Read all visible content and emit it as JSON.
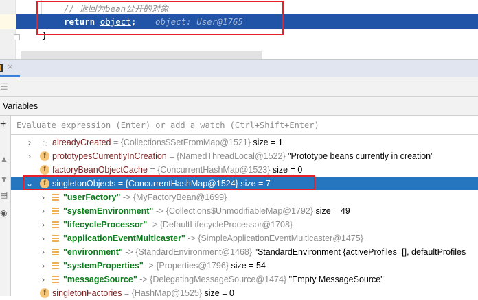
{
  "editor": {
    "comment": "// 返回为bean公开的对象",
    "return_kw": "return ",
    "return_obj": "object",
    "return_semi": ";",
    "inline_value": "object: User@1765",
    "brace": "}"
  },
  "toolbar": {
    "close_glyph": "×"
  },
  "variables": {
    "title": "Variables",
    "eval_placeholder": "Evaluate expression (Enter) or add a watch (Ctrl+Shift+Enter)",
    "add_glyph": "+",
    "rows": [
      {
        "name": "alreadyCreated",
        "value": " = {Collections$SetFromMap@1521}",
        "extra": "  size = 1"
      },
      {
        "name": "prototypesCurrentlyInCreation",
        "value": " = {NamedThreadLocal@1522}",
        "extra": " \"Prototype beans currently in creation\""
      },
      {
        "name": "factoryBeanObjectCache",
        "value": " = {ConcurrentHashMap@1523}",
        "extra": "  size = 0"
      },
      {
        "name": "singletonObjects",
        "value": " = {ConcurrentHashMap@1524}",
        "extra": "  size = 7"
      },
      {
        "key": "\"userFactory\"",
        "value": " -> {MyFactoryBean@1699}",
        "extra": ""
      },
      {
        "key": "\"systemEnvironment\"",
        "value": " -> {Collections$UnmodifiableMap@1792}",
        "extra": "  size = 49"
      },
      {
        "key": "\"lifecycleProcessor\"",
        "value": " -> {DefaultLifecycleProcessor@1708}",
        "extra": ""
      },
      {
        "key": "\"applicationEventMulticaster\"",
        "value": " -> {SimpleApplicationEventMulticaster@1475}",
        "extra": ""
      },
      {
        "key": "\"environment\"",
        "value": " -> {StandardEnvironment@1468}",
        "extra": " \"StandardEnvironment {activeProfiles=[], defaultProfiles"
      },
      {
        "key": "\"systemProperties\"",
        "value": " -> {Properties@1796}",
        "extra": "  size = 54"
      },
      {
        "key": "\"messageSource\"",
        "value": " -> {DelegatingMessageSource@1474}",
        "extra": " \"Empty MessageSource\""
      },
      {
        "name": "singletonFactories",
        "value": " = {HashMap@1525}",
        "extra": "  size = 0"
      }
    ]
  },
  "colors": {
    "selection": "#2675bf",
    "exec_line": "#2154a6",
    "highlight_box": "#e8202a"
  }
}
